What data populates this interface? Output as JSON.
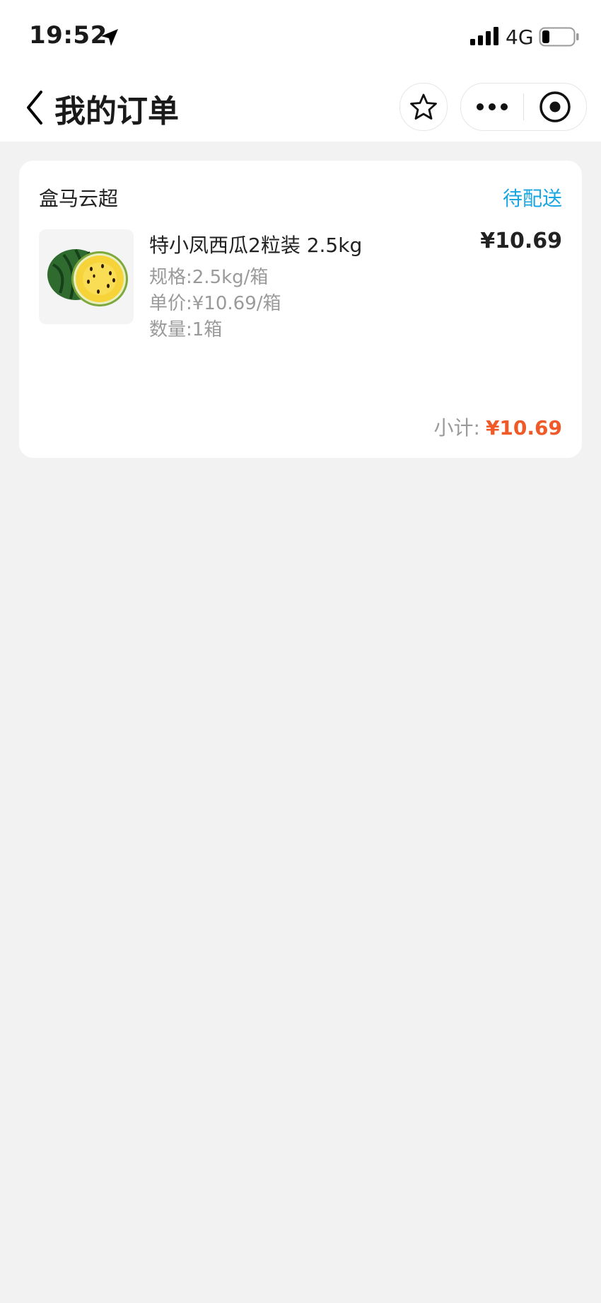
{
  "status_bar": {
    "time": "19:52",
    "network": "4G",
    "icons": [
      "location-arrow-icon",
      "signal-bars-icon",
      "battery-icon"
    ]
  },
  "nav": {
    "title": "我的订单",
    "icons": [
      "back-chevron-icon",
      "star-icon",
      "more-dots-icon",
      "close-circle-icon"
    ]
  },
  "order": {
    "store": "盒马云超",
    "status": "待配送",
    "item": {
      "name": "特小凤西瓜2粒装 2.5kg",
      "price": "¥10.69",
      "spec": "规格:2.5kg/箱",
      "unit_price": "单价:¥10.69/箱",
      "quantity": "数量:1箱"
    },
    "subtotal_label": "小计:",
    "subtotal_value": "¥10.69"
  },
  "colors": {
    "status": "#1aa6e0",
    "subtotal": "#f05a28",
    "background": "#f2f2f2"
  }
}
